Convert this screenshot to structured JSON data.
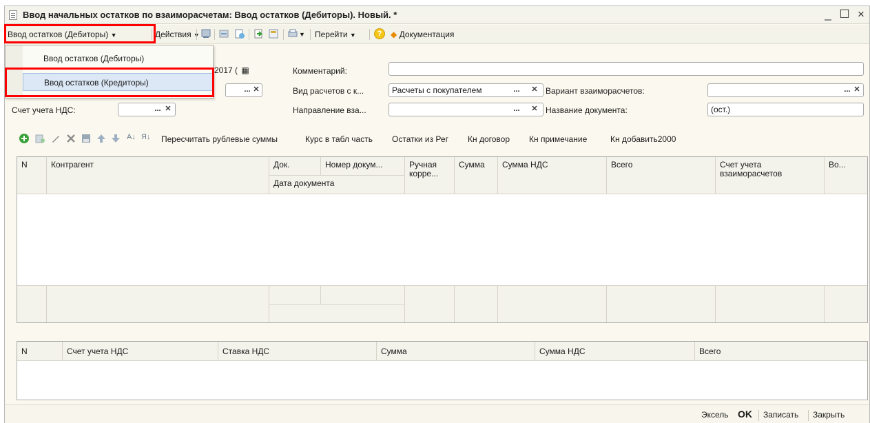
{
  "window": {
    "title": "Ввод начальных остатков по взаиморасчетам: Ввод остатков (Дебиторы). Новый. *",
    "buttons": [
      "_",
      "☐",
      "×"
    ]
  },
  "toolbar": {
    "mode_button": "Ввод остатков (Дебиторы)",
    "actions": "Действия",
    "goto": "Перейти",
    "help_icon": "?",
    "documentation": "Документация",
    "icons": [
      "post-icon",
      "unpost-icon",
      "copy-doc-icon",
      "based-on-icon",
      "structure-icon",
      "print-icon"
    ]
  },
  "dropdown": {
    "items": [
      "Ввод остатков (Дебиторы)",
      "Ввод остатков (Кредиторы)"
    ],
    "selected_index": 1
  },
  "form": {
    "date_value": "2017 (",
    "comment_label": "Комментарий:",
    "comment_value": "",
    "calc_type_label": "Вид расчетов с к...",
    "calc_type_value": "Расчеты с покупателем",
    "settlement_variant_label": "Вариант взаиморасчетов:",
    "settlement_variant_value": "",
    "vat_account_label": "Счет учета НДС:",
    "vat_account_value": "",
    "direction_label": "Направление вза...",
    "direction_value": "",
    "doc_name_label": "Название документа:",
    "doc_name_value": "(ост.)"
  },
  "table_toolbar": {
    "buttons": [
      "Пересчитать рублевые суммы",
      "Курс в табл часть",
      "Остатки из Рег",
      "Кн договор",
      "Кн примечание",
      "Кн добавить2000"
    ]
  },
  "grid1": {
    "headers": {
      "n": "N",
      "counterparty": "Контрагент",
      "doc": "Док.",
      "doc_number": "Номер докум...",
      "doc_date": "Дата документа",
      "manual_corr": "Ручная корре...",
      "sum": "Сумма",
      "vat_sum": "Сумма НДС",
      "total": "Всего",
      "settlement_account": "Счет учета взаиморасчетов",
      "extra": "Во..."
    },
    "rows": []
  },
  "grid2": {
    "headers": {
      "n": "N",
      "vat_account": "Счет учета НДС",
      "vat_rate": "Ставка НДС",
      "sum": "Сумма",
      "vat_sum": "Сумма НДС",
      "total": "Всего"
    },
    "rows": []
  },
  "bottom": {
    "excel": "Эксель",
    "ok": "OK",
    "save": "Записать",
    "close": "Закрыть"
  },
  "colors": {
    "highlight_border": "#ff0000",
    "selected_item_bg": "#dce8f6",
    "window_bg": "#fbf9ef"
  }
}
